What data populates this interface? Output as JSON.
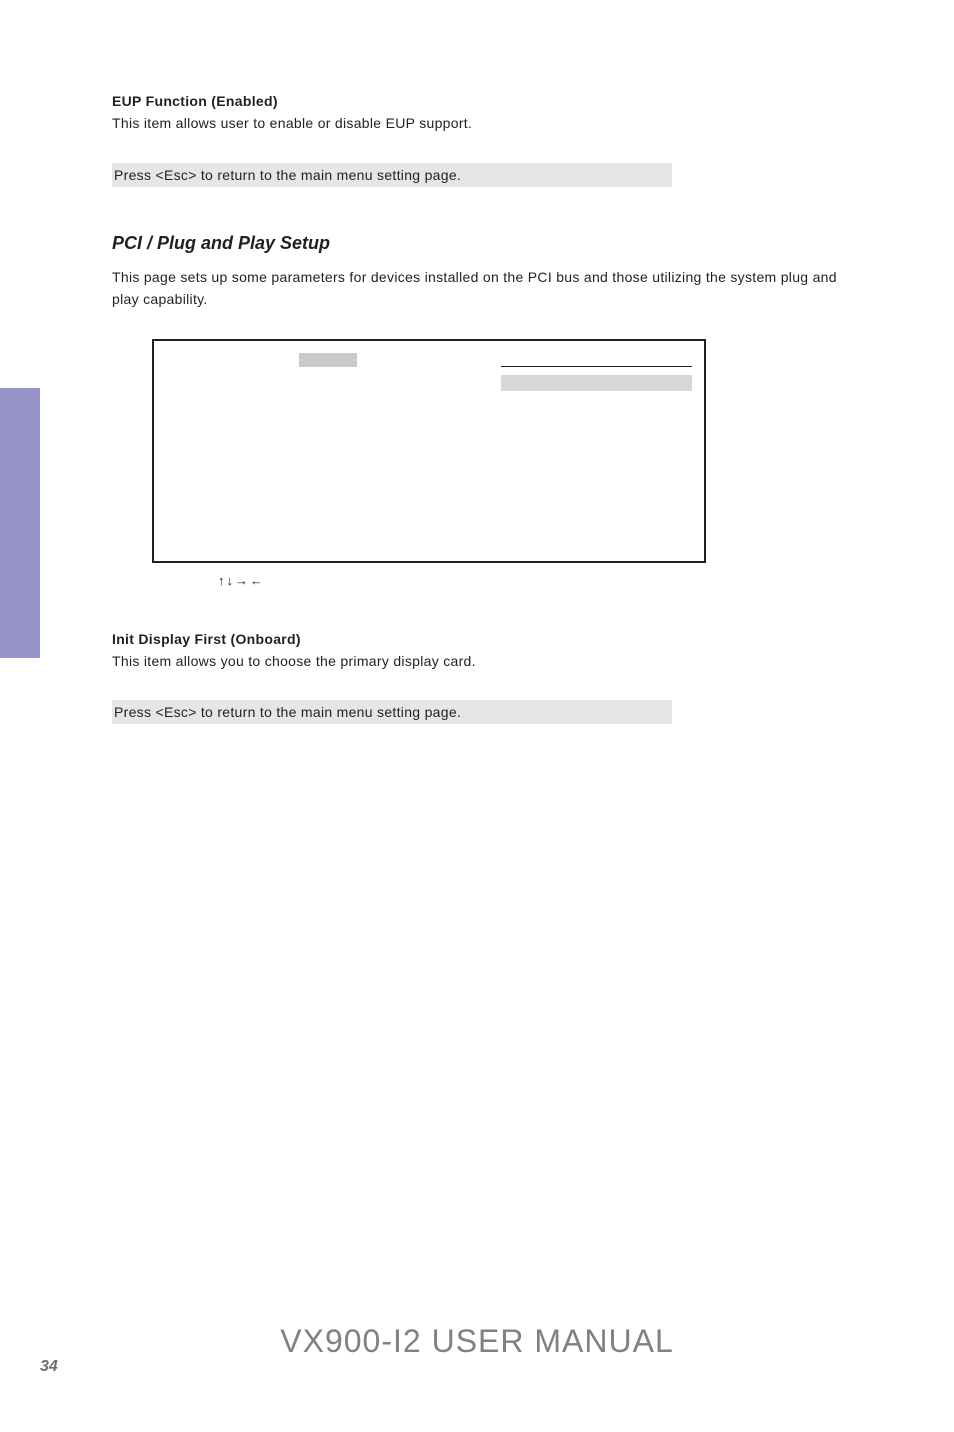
{
  "eup": {
    "heading": "EUP Function (Enabled)",
    "body": "This item allows user to enable or disable EUP support."
  },
  "note1": "Press <Esc> to return to the main menu setting page.",
  "pci": {
    "title": "PCI / Plug and Play Setup",
    "body": "This page sets up some parameters for devices installed on the PCI bus and those utilizing the system plug and play capability."
  },
  "arrows": "↑↓→←",
  "init": {
    "heading": "Init Display First (Onboard)",
    "body": "This item allows you to choose the primary display card."
  },
  "note2": "Press <Esc> to return to the main menu setting page.",
  "footer": "VX900-I2 USER MANUAL",
  "pagenum": "34"
}
